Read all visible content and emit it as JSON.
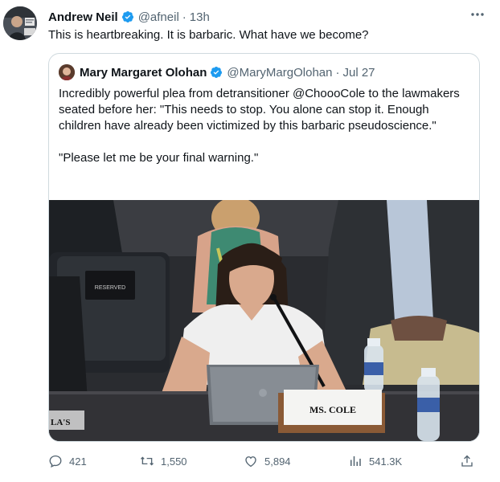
{
  "tweet": {
    "author_name": "Andrew Neil",
    "author_handle": "@afneil",
    "separator": "·",
    "time": "13h",
    "more_icon": "more-horizontal-icon",
    "text": "This is heartbreaking. It is barbaric. What have we become?"
  },
  "quoted": {
    "author_name": "Mary Margaret Olohan",
    "author_handle": "@MaryMargOlohan",
    "separator": "·",
    "date": "Jul 27",
    "paragraph_1": "Incredibly powerful plea from detransitioner @ChoooCole to the lawmakers seated before her: \"This needs to stop. You alone can stop it. Enough children have already been victimized by this barbaric pseudoscience.\"",
    "paragraph_2": "\"Please let me be your final warning.\"",
    "media": {
      "reserved_sign": "RESERVED",
      "nameplate": "MS. COLE",
      "corner_watermark": "LA'S"
    }
  },
  "actions": {
    "replies": "421",
    "retweets": "1,550",
    "likes": "5,894",
    "views": "541.3K"
  },
  "colors": {
    "text_primary": "#0f1419",
    "text_secondary": "#536471",
    "verified_blue": "#1d9bf0",
    "border": "#cfd9de"
  }
}
